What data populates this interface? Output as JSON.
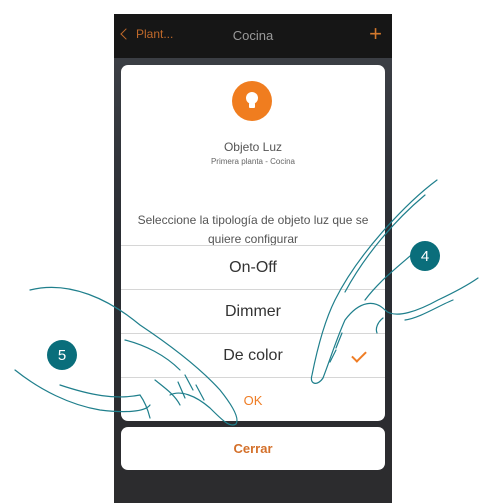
{
  "navbar": {
    "back_label": "Plant...",
    "title": "Cocina",
    "add_symbol": "+"
  },
  "dialog": {
    "object_title": "Objeto Luz",
    "object_subtitle": "Primera planta - Cocina",
    "prompt": "Seleccione la tipología de objeto luz que se quiere configurar",
    "options": [
      {
        "label": "On-Off",
        "selected": false
      },
      {
        "label": "Dimmer",
        "selected": false
      },
      {
        "label": "De color",
        "selected": true
      }
    ],
    "ok_label": "OK",
    "icon": "light-bulb-icon"
  },
  "close_label": "Cerrar",
  "steps": {
    "step4": "4",
    "step5": "5"
  },
  "colors": {
    "accent": "#ef7d25",
    "badge": "#0a6e7b",
    "navbar": "#161616"
  }
}
